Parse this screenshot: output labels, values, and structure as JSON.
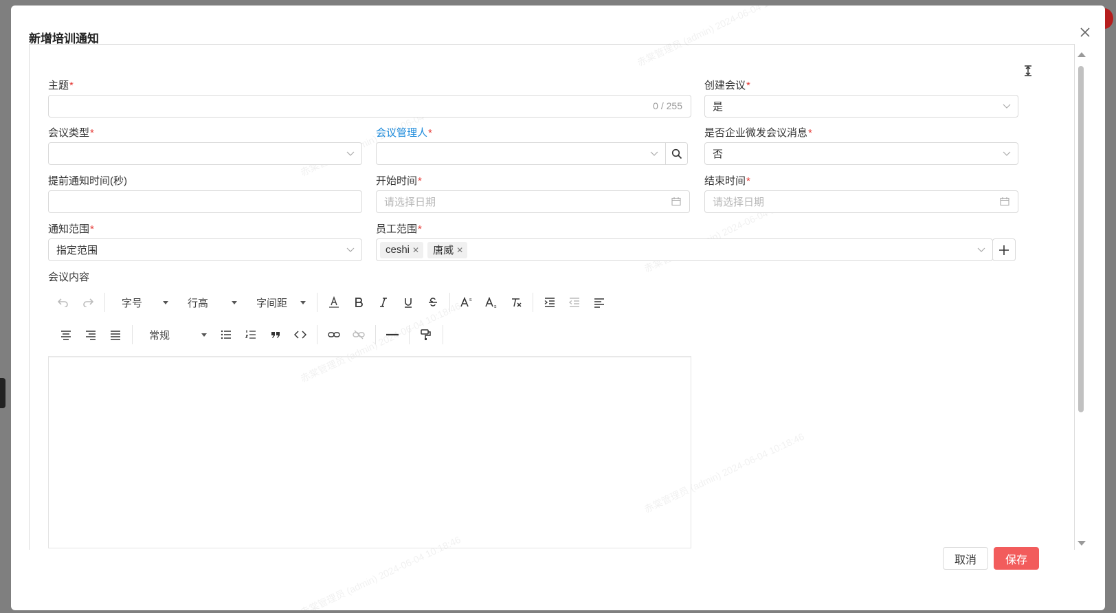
{
  "dialog": {
    "title": "新增培训通知"
  },
  "watermark": "赤棠管理员 (admin) 2024-06-04 10:18:46",
  "fields": {
    "subject": {
      "label": "主题",
      "required": true,
      "value": "",
      "counter": "0 / 255"
    },
    "create_meeting": {
      "label": "创建会议",
      "required": true,
      "value": "是"
    },
    "meeting_type": {
      "label": "会议类型",
      "required": true,
      "value": ""
    },
    "meeting_manager": {
      "label": "会议管理人",
      "required": true,
      "value": ""
    },
    "wecom_message": {
      "label": "是否企业微发会议消息",
      "required": true,
      "value": "否"
    },
    "advance_notice": {
      "label": "提前通知时间(秒)",
      "required": false,
      "value": ""
    },
    "start_time": {
      "label": "开始时间",
      "required": true,
      "placeholder": "请选择日期"
    },
    "end_time": {
      "label": "结束时间",
      "required": true,
      "placeholder": "请选择日期"
    },
    "notice_scope": {
      "label": "通知范围",
      "required": true,
      "value": "指定范围"
    },
    "employee_scope": {
      "label": "员工范围",
      "required": true,
      "tags": [
        "ceshi",
        "唐威"
      ]
    },
    "content": {
      "label": "会议内容"
    }
  },
  "required_mark": "*",
  "editor": {
    "row1": [
      "undo",
      "redo",
      "|",
      "字号",
      "行高",
      "字间距",
      "|",
      "A",
      "B",
      "I",
      "U",
      "S",
      "|",
      "A^s",
      "A_s",
      "Tx",
      "|",
      "indent",
      "outdent",
      "align-left"
    ],
    "font_size_label": "字号",
    "line_height_label": "行高",
    "letter_spacing_label": "字间距",
    "paragraph_label": "常规"
  },
  "footer": {
    "cancel_label": "取消",
    "save_label": "保存"
  },
  "colors": {
    "primary": "#f25c5c",
    "link": "#1c8adb",
    "required": "#e53935"
  }
}
